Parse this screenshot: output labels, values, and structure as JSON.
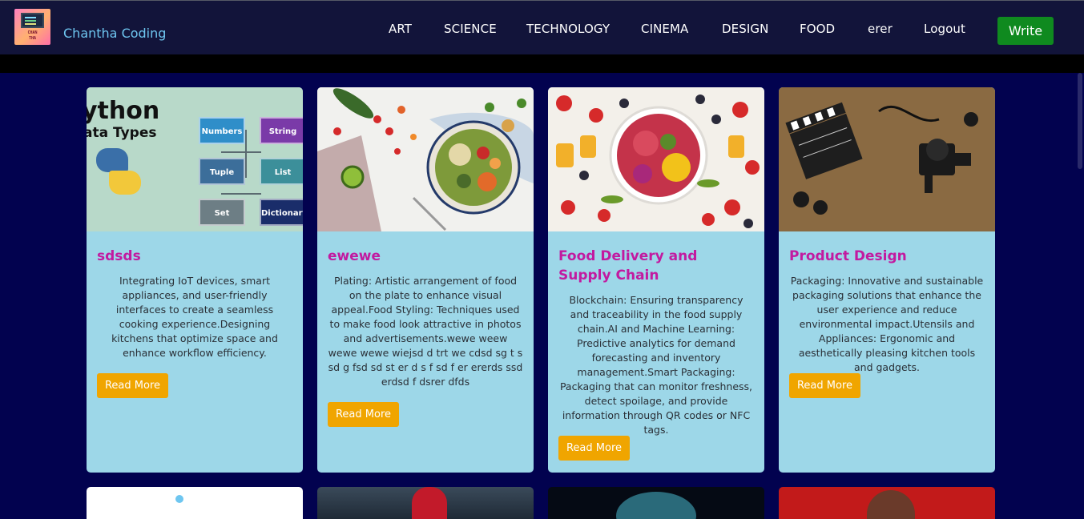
{
  "nav": {
    "logo_lines": [
      "CHAN",
      "THA"
    ],
    "brand": "Chantha Coding",
    "links": [
      "ART",
      "SCIENCE",
      "TECHNOLOGY",
      "CINEMA",
      "DESIGN",
      "FOOD",
      "erer",
      "Logout"
    ],
    "write": "Write"
  },
  "python_image": {
    "heading1": "ython",
    "heading2": "ata Types",
    "boxes": [
      "Numbers",
      "String",
      "Tuple",
      "List",
      "Set",
      "Dictionary"
    ]
  },
  "cards": [
    {
      "title": "sdsds",
      "description": "Integrating IoT devices, smart appliances, and user-friendly interfaces to create a seamless cooking experience.Designing kitchens that optimize space and enhance workflow efficiency.",
      "button": "Read More"
    },
    {
      "title": "ewewe",
      "description": "Plating: Artistic arrangement of food on the plate to enhance visual appeal.Food Styling: Techniques used to make food look attractive in photos and advertisements.wewe weew wewe wewe wiejsd d trt we cdsd sg t s sd g fsd sd st er d s f sd f er ererds ssd erdsd f dsrer dfds",
      "button": "Read More"
    },
    {
      "title": "Food Delivery and Supply Chain",
      "description": "Blockchain: Ensuring transparency and traceability in the food supply chain.AI and Machine Learning: Predictive analytics for demand forecasting and inventory management.Smart Packaging: Packaging that can monitor freshness, detect spoilage, and provide information through QR codes or NFC tags.",
      "button": "Read More"
    },
    {
      "title": "Product Design",
      "description": "Packaging: Innovative and sustainable packaging solutions that enhance the user experience and reduce environmental impact.Utensils and Appliances: Ergonomic and aesthetically pleasing kitchen tools and gadgets.",
      "button": "Read More"
    }
  ],
  "colors": {
    "navbar": "#12143a",
    "page_background": "#02024f",
    "card_background": "#9dd7e8",
    "card_title": "#c21aa0",
    "read_more_button": "#f0a500",
    "write_button": "#0f8a1f",
    "brand_text": "#6ec6f0"
  }
}
